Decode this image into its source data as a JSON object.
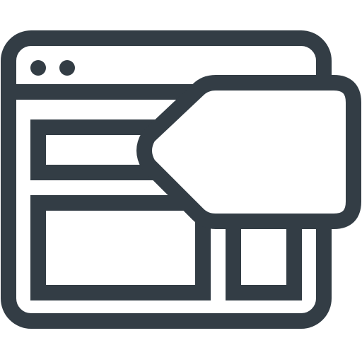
{
  "icon": {
    "name": "browser-window-with-price-tag-icon",
    "stroke_color": "#333d45",
    "fill_color": "#ffffff",
    "background_color": "#ffffff"
  }
}
